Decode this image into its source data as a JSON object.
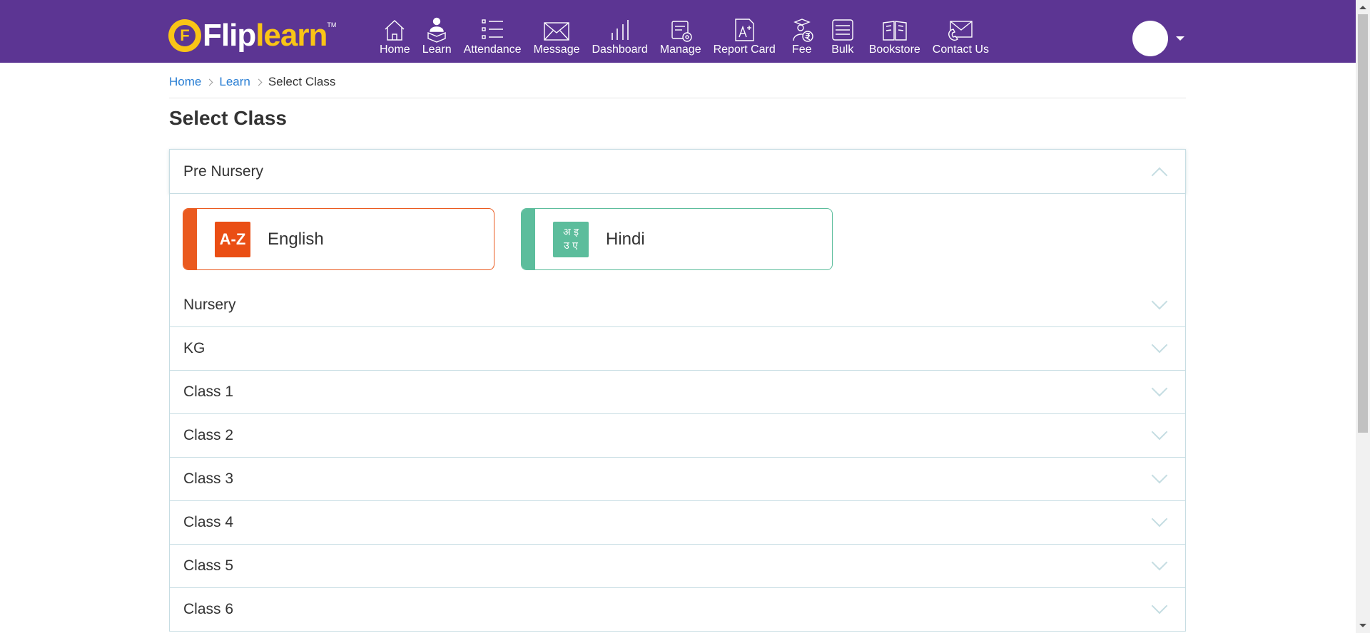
{
  "brand": {
    "badge_letter": "F",
    "name_part1": "Flip",
    "name_part2": "learn",
    "trademark": "TM",
    "colors": {
      "header": "#5c3593",
      "logo_yellow": "#f9c416"
    }
  },
  "nav": {
    "items": [
      {
        "label": "Home",
        "icon": "home-icon"
      },
      {
        "label": "Learn",
        "icon": "learn-icon"
      },
      {
        "label": "Attendance",
        "icon": "attendance-list-icon"
      },
      {
        "label": "Message",
        "icon": "envelope-icon"
      },
      {
        "label": "Dashboard",
        "icon": "bar-chart-icon"
      },
      {
        "label": "Manage",
        "icon": "manage-settings-icon"
      },
      {
        "label": "Report Card",
        "icon": "report-card-icon"
      },
      {
        "label": "Fee",
        "icon": "fee-rupee-icon"
      },
      {
        "label": "Bulk",
        "icon": "bulk-stack-icon"
      },
      {
        "label": "Bookstore",
        "icon": "book-icon"
      },
      {
        "label": "Contact Us",
        "icon": "contact-envelope-icon"
      }
    ]
  },
  "breadcrumb": {
    "home": "Home",
    "learn": "Learn",
    "current": "Select Class"
  },
  "page": {
    "title": "Select Class"
  },
  "classes": {
    "open": {
      "name": "Pre Nursery",
      "subjects": [
        {
          "label": "English",
          "icon_text": "A-Z",
          "color": "#ea5a1f"
        },
        {
          "label": "Hindi",
          "icon_line1": "अ इ",
          "icon_line2": "उ ए",
          "color": "#5cbd9c"
        }
      ]
    },
    "collapsed": [
      "Nursery",
      "KG",
      "Class 1",
      "Class 2",
      "Class 3",
      "Class 4",
      "Class 5",
      "Class 6"
    ]
  }
}
